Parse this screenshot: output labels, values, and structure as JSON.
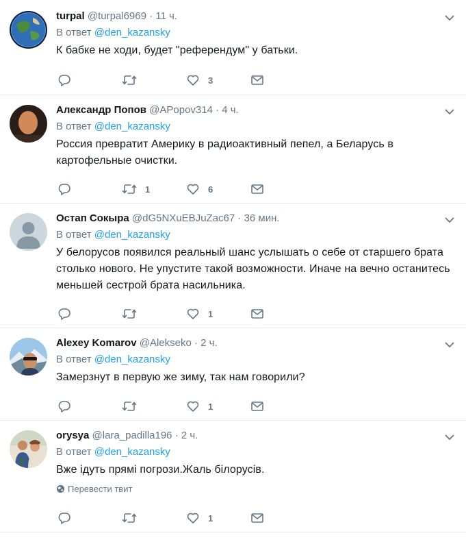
{
  "reply_prefix": "В ответ",
  "tweets": [
    {
      "name": "turpal",
      "handle": "@turpal6969",
      "dot": "·",
      "time": "11 ч.",
      "reply_to": "@den_kazansky",
      "text": "К бабке не ходи, будет \"референдум\" у батьки.",
      "replies": "",
      "retweets": "",
      "likes": "3",
      "avatar": "earth-globe"
    },
    {
      "name": "Александр Попов",
      "handle": "@APopov314",
      "dot": "·",
      "time": "4 ч.",
      "reply_to": "@den_kazansky",
      "text": "Россия превратит Америку в радиоактивный пепел, а Беларусь в картофельные очистки.",
      "replies": "",
      "retweets": "1",
      "likes": "6",
      "avatar": "man-photo"
    },
    {
      "name": "Остап Сокыра",
      "handle": "@dG5NXuEBJuZac67",
      "dot": "·",
      "time": "36 мин.",
      "reply_to": "@den_kazansky",
      "text": "У белорусов появился реальный шанс услышать о себе от старшего брата столько нового. Не упустите такой возможности. Иначе на вечно останитесь меньшей сестрой брата насильника.",
      "replies": "",
      "retweets": "",
      "likes": "1",
      "avatar": "default-silhouette"
    },
    {
      "name": "Alexey Komarov",
      "handle": "@Alekseko",
      "dot": "·",
      "time": "2 ч.",
      "reply_to": "@den_kazansky",
      "text": "Замерзнут в первую же зиму, так нам говорили?",
      "replies": "",
      "retweets": "",
      "likes": "1",
      "avatar": "mountain-selfie"
    },
    {
      "name": "orysya",
      "handle": "@lara_padilla196",
      "dot": "·",
      "time": "2 ч.",
      "reply_to": "@den_kazansky",
      "text": "Вже ідуть прямі погрози.Жаль білорусів.",
      "translate": "Перевести твит",
      "replies": "",
      "retweets": "",
      "likes": "1",
      "avatar": "couple-photo"
    }
  ],
  "colors": {
    "link": "#1da1f2",
    "muted": "#657786",
    "divider": "#e6ecf0",
    "text": "#14171a"
  }
}
